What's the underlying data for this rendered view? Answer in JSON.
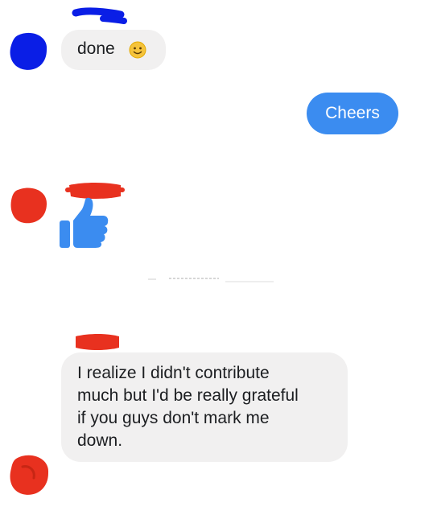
{
  "messages": [
    {
      "direction": "incoming",
      "text": "done",
      "emoji": "slightly-smiling-face-icon"
    },
    {
      "direction": "outgoing",
      "text": "Cheers"
    },
    {
      "direction": "incoming",
      "type": "sticker",
      "sticker": "thumbs-up-icon"
    },
    {
      "direction": "incoming",
      "text": "I realize I didn't contribute much but I'd be really grateful if you guys don't mark me down.",
      "lines": [
        "I realize I didn't contribute",
        "much but I'd be really grateful",
        "if you guys don't mark me",
        "down."
      ]
    }
  ],
  "colors": {
    "incoming_bubble": "#f1f0f0",
    "outgoing_bubble": "#3b8cf0",
    "thumbs_up": "#3b8cf0",
    "redaction_blue": "#0a1ee6",
    "redaction_red": "#e8311f"
  }
}
